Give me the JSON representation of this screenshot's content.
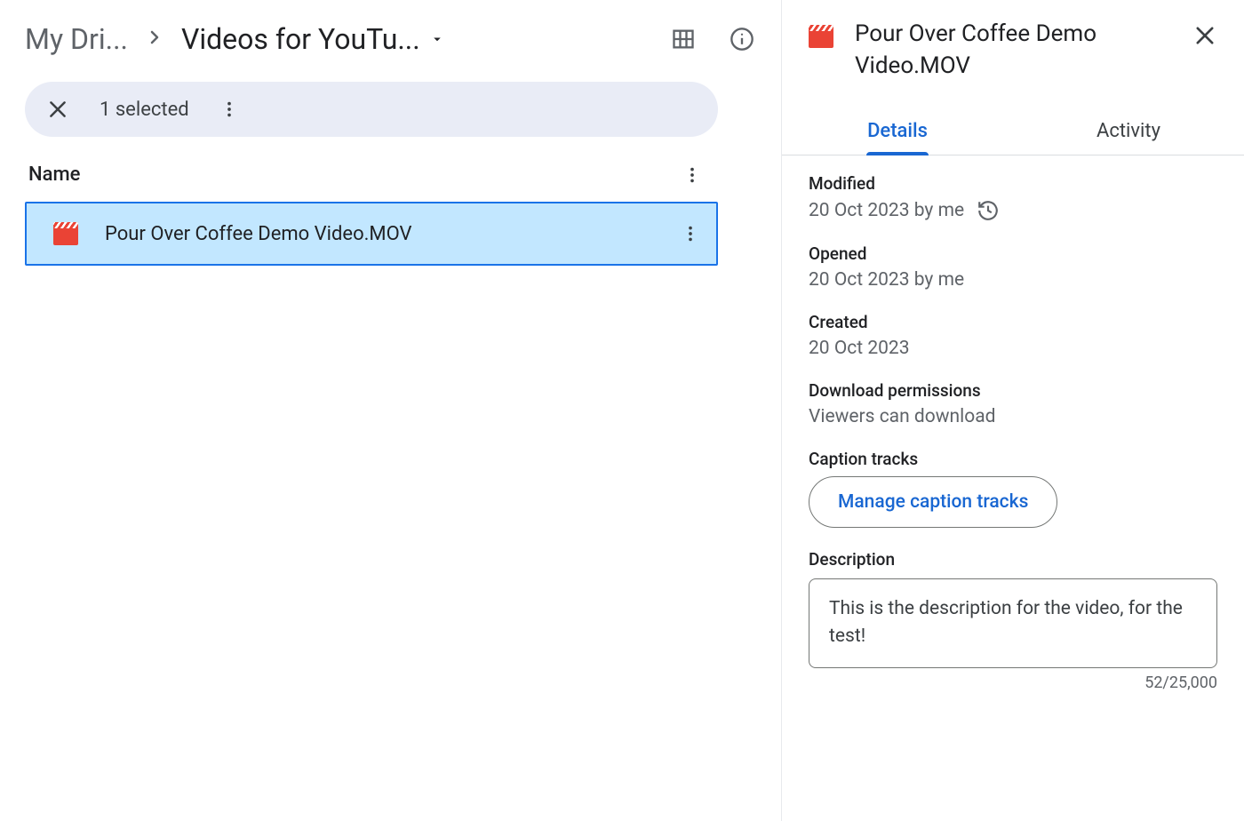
{
  "breadcrumb": {
    "root": "My Dri...",
    "current": "Videos for YouTu..."
  },
  "selection": {
    "count_label": "1 selected"
  },
  "list": {
    "header_name": "Name",
    "file_name": "Pour Over Coffee Demo Video.MOV"
  },
  "panel": {
    "title": "Pour Over Coffee Demo Video.MOV",
    "tabs": {
      "details": "Details",
      "activity": "Activity"
    },
    "modified_label": "Modified",
    "modified_value": "20 Oct 2023 by me",
    "opened_label": "Opened",
    "opened_value": "20 Oct 2023 by me",
    "created_label": "Created",
    "created_value": "20 Oct 2023",
    "download_label": "Download permissions",
    "download_value": "Viewers can download",
    "caption_label": "Caption tracks",
    "caption_button": "Manage caption tracks",
    "description_label": "Description",
    "description_value": "This is the description for the video, for the test!",
    "char_count": "52/25,000"
  }
}
